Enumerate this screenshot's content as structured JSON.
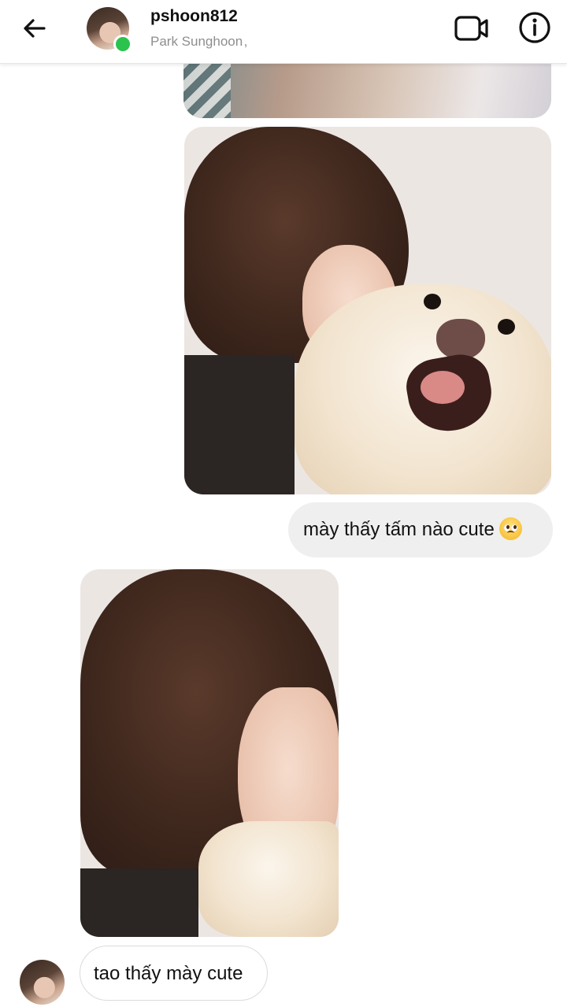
{
  "header": {
    "username": "pshoon812",
    "fullname": "Park Sunghoon ,",
    "status": "online",
    "status_color": "#2bc34d",
    "icons": [
      "back-arrow-icon",
      "video-call-icon",
      "info-icon"
    ]
  },
  "messages": [
    {
      "type": "image",
      "side": "sent",
      "description_icon": "photo"
    },
    {
      "type": "image",
      "side": "sent",
      "description_icon": "photo"
    },
    {
      "type": "text",
      "side": "sent",
      "text": "mày thấy tấm nào cute",
      "emoji": "pleading-face-emoji"
    },
    {
      "type": "image",
      "side": "received",
      "description_icon": "photo"
    },
    {
      "type": "text",
      "side": "received",
      "text": "tao thấy mày cute"
    }
  ],
  "colors": {
    "sent_bubble": "#efefef",
    "received_bubble_border": "#dbdbdb",
    "secondary_text": "#8e8e8e"
  }
}
